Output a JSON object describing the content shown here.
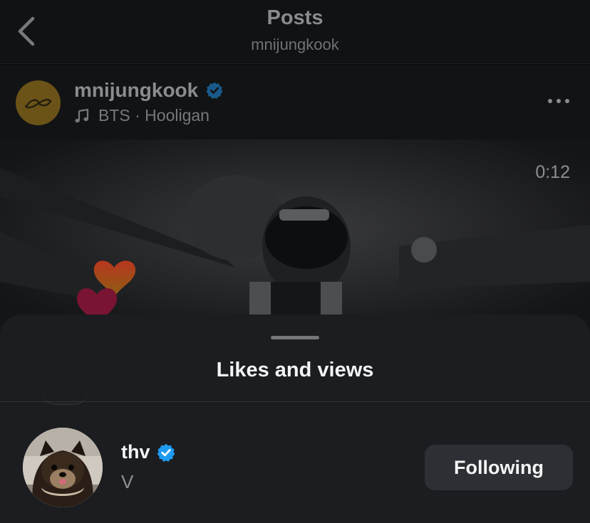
{
  "nav": {
    "title": "Posts",
    "subtitle": "mnijungkook"
  },
  "post": {
    "username": "mnijungkook",
    "music": "BTS · Hooligan",
    "timecode": "0:12"
  },
  "sheet": {
    "title": "Likes and views",
    "rows": [
      {
        "name": "thv",
        "subtitle": "V",
        "button_label": "Following"
      }
    ]
  },
  "colors": {
    "verified": "#1d9bf0",
    "sheet_bg": "#1b1d20",
    "button_bg": "#2c2f33"
  },
  "icons": [
    "back-chevron-icon",
    "verified-badge-icon",
    "music-note-icon",
    "more-options-icon",
    "heart-icon"
  ]
}
